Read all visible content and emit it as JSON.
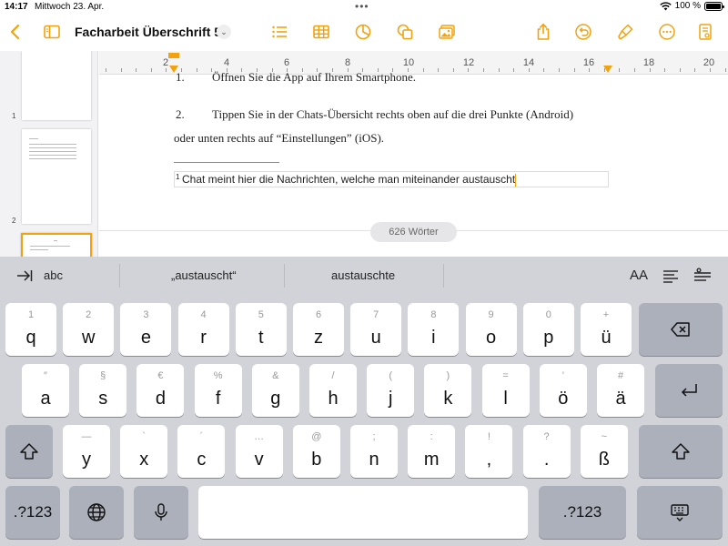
{
  "status_bar": {
    "time": "14:17",
    "date": "Mittwoch 23. Apr.",
    "battery": "100 %",
    "battery_level": 1.0
  },
  "toolbar": {
    "back_icon": "chevron-left-icon",
    "sidebar_icon": "sidebar-icon",
    "title": "Facharbeit Überschrift 5",
    "title_chevron": "⌄",
    "icons": [
      "list-icon",
      "table-icon",
      "chart-icon",
      "shapes-icon",
      "media-icon",
      "share-icon",
      "undo-icon",
      "format-brush-icon",
      "more-icon",
      "document-options-icon"
    ],
    "accent_color": "#f2a20e"
  },
  "sidebar": {
    "pages": [
      "1",
      "2"
    ]
  },
  "ruler": {
    "labels": [
      "2",
      "4",
      "6",
      "8",
      "10",
      "12",
      "14",
      "16",
      "18",
      "20"
    ]
  },
  "document": {
    "line1_num": "1.",
    "line1_text": "Öffnen Sie die App auf Ihrem Smartphone.",
    "line2_num": "2.",
    "line2_text": "Tippen Sie in der Chats-Übersicht rechts oben auf die drei Punkte (Android)",
    "line3_text": "oder unten rechts auf “Einstellungen” (iOS).",
    "footnote_num": "1",
    "footnote_text": "Chat meint hier die Nachrichten, welche man miteinander austauscht",
    "word_count": "626 Wörter"
  },
  "keyboard": {
    "abc_label": "abc",
    "suggestions": [
      "„austauscht“",
      "austauschte"
    ],
    "format_label": "AA",
    "row1": [
      {
        "main": "q",
        "sec": "1"
      },
      {
        "main": "w",
        "sec": "2"
      },
      {
        "main": "e",
        "sec": "3"
      },
      {
        "main": "r",
        "sec": "4"
      },
      {
        "main": "t",
        "sec": "5"
      },
      {
        "main": "z",
        "sec": "6"
      },
      {
        "main": "u",
        "sec": "7"
      },
      {
        "main": "i",
        "sec": "8"
      },
      {
        "main": "o",
        "sec": "9"
      },
      {
        "main": "p",
        "sec": "0"
      },
      {
        "main": "ü",
        "sec": "+"
      }
    ],
    "row2": [
      {
        "main": "a",
        "sec": "″"
      },
      {
        "main": "s",
        "sec": "§"
      },
      {
        "main": "d",
        "sec": "€"
      },
      {
        "main": "f",
        "sec": "%"
      },
      {
        "main": "g",
        "sec": "&"
      },
      {
        "main": "h",
        "sec": "/"
      },
      {
        "main": "j",
        "sec": "("
      },
      {
        "main": "k",
        "sec": ")"
      },
      {
        "main": "l",
        "sec": "="
      },
      {
        "main": "ö",
        "sec": "’"
      },
      {
        "main": "ä",
        "sec": "#"
      }
    ],
    "row3": [
      {
        "main": "y",
        "sec": "—"
      },
      {
        "main": "x",
        "sec": "`"
      },
      {
        "main": "c",
        "sec": "´"
      },
      {
        "main": "v",
        "sec": "…"
      },
      {
        "main": "b",
        "sec": "@"
      },
      {
        "main": "n",
        "sec": ";"
      },
      {
        "main": "m",
        "sec": ":"
      },
      {
        "main": ",",
        "sec": "!"
      },
      {
        "main": ".",
        "sec": "?"
      },
      {
        "main": "ß",
        "sec": "~"
      }
    ],
    "numbers_label": ".?123"
  }
}
